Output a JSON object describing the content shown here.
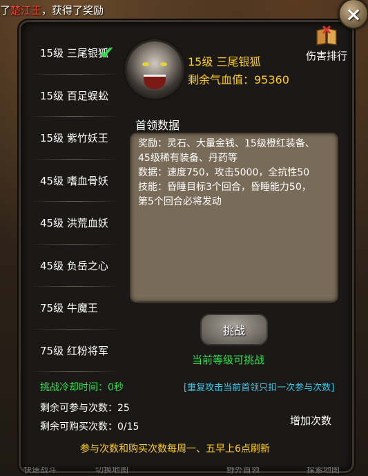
{
  "broadcast": {
    "prefix": "了",
    "highlight": "楚江王",
    "suffix": "，获得了奖励"
  },
  "close_icon": "×",
  "boss_list": [
    {
      "label": "15级 三尾银狐",
      "selected": true
    },
    {
      "label": "15级 百足蜈蚣"
    },
    {
      "label": "15级 紫竹妖王"
    },
    {
      "label": "45级 嗜血骨妖"
    },
    {
      "label": "45级 洪荒血妖"
    },
    {
      "label": "45级 负岳之心"
    },
    {
      "label": "75级 牛魔王"
    },
    {
      "label": "75级 红粉将军"
    }
  ],
  "boss": {
    "name": "15级 三尾银狐",
    "hp": "剩余气血值：95360"
  },
  "rank_button": "伤害排行",
  "section_title": "首领数据",
  "info": {
    "line1": "奖励：灵石、大量金钱、15级橙红装备、",
    "line2": "45级稀有装备、丹药等",
    "line3": "数据：速度750，攻击5000，全抗性50",
    "line4": "技能：昏睡目标3个回合，昏睡能力50，",
    "line5": "第5个回合必将发动"
  },
  "challenge_button": "挑战",
  "can_challenge": "当前等级可挑战",
  "cooldown": "挑战冷却时间：0秒",
  "repeat_note": "[重复攻击当前首领只扣一次参与次数]",
  "remaining_attempts": "剩余可参与次数：25",
  "remaining_buys": "剩余可购买次数：0/15",
  "add_button": "增加次数",
  "refresh_note": "参与次数和购买次数每周一、五早上6点刷新",
  "bottom_nav": [
    "快速战斗",
    "切换地图",
    "野外首领",
    "探索地图"
  ],
  "colors": {
    "green": "#2ee04a",
    "gold": "#ffcc22",
    "cyan": "#38c8e8",
    "red": "#ff3b2f"
  }
}
